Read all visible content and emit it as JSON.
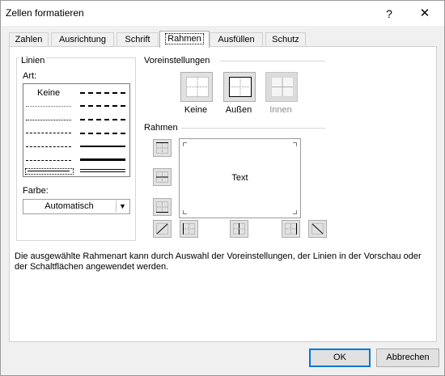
{
  "dialog": {
    "title": "Zellen formatieren",
    "help": "?",
    "close": "✕"
  },
  "tabs": [
    {
      "label": "Zahlen",
      "active": false
    },
    {
      "label": "Ausrichtung",
      "active": false
    },
    {
      "label": "Schrift",
      "active": false
    },
    {
      "label": "Rahmen",
      "active": true
    },
    {
      "label": "Ausfüllen",
      "active": false
    },
    {
      "label": "Schutz",
      "active": false
    }
  ],
  "linien": {
    "group_label": "Linien",
    "art_label": "Art:",
    "none_label": "Keine",
    "farbe_label": "Farbe:",
    "color_value": "Automatisch"
  },
  "voreinstellungen": {
    "group_label": "Voreinstellungen",
    "keine": "Keine",
    "aussen": "Außen",
    "innen": "Innen"
  },
  "rahmen": {
    "group_label": "Rahmen",
    "preview_text": "Text"
  },
  "info": "Die ausgewählte Rahmenart kann durch Auswahl der Voreinstellungen, der Linien in der Vorschau oder der Schaltflächen angewendet werden.",
  "buttons": {
    "ok": "OK",
    "cancel": "Abbrechen"
  }
}
